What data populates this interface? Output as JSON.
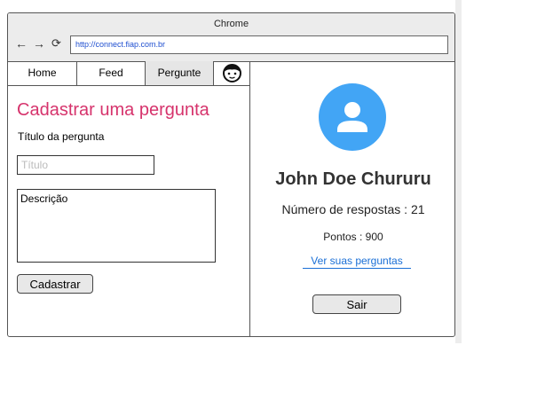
{
  "window": {
    "title": "Chrome",
    "url": "http://connect.fiap.com.br"
  },
  "nav": {
    "back_icon": "←",
    "forward_icon": "→",
    "reload_icon": "⟳"
  },
  "tabs": [
    {
      "label": "Home"
    },
    {
      "label": "Feed"
    },
    {
      "label": "Pergunte"
    }
  ],
  "form": {
    "title": "Cadastrar uma pergunta",
    "question_label": "Título da pergunta",
    "title_placeholder": "Título",
    "description_placeholder": "Descrição",
    "submit_label": "Cadastrar"
  },
  "profile": {
    "name": "John Doe Chururu",
    "answers_text": "Número de respostas : 21",
    "points_text": "Pontos : 900",
    "link_text": "Ver suas perguntas",
    "logout_label": "Sair"
  },
  "colors": {
    "accent_pink": "#d6336c",
    "avatar_blue": "#42a5f5",
    "link_blue": "#1a6fd6"
  }
}
